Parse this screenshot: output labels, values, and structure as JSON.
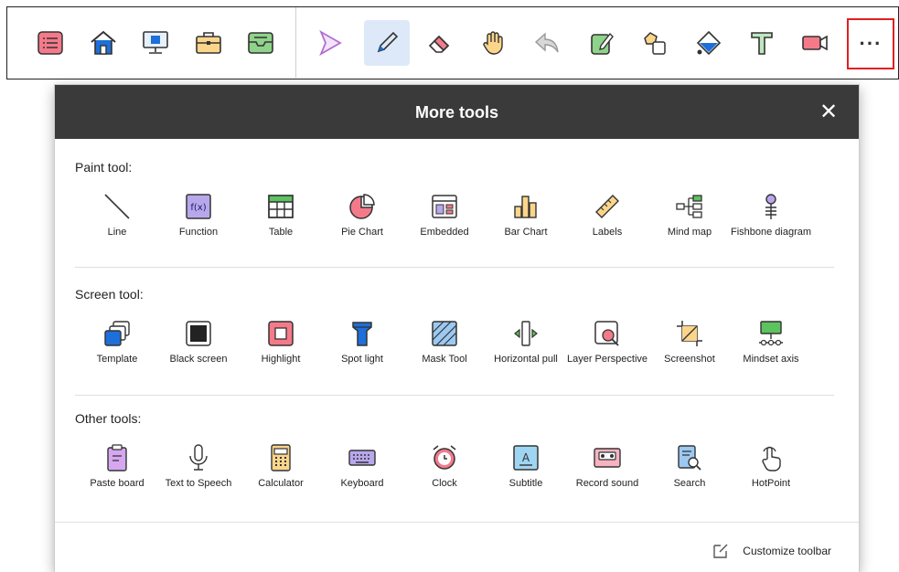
{
  "toolbar": {
    "left_tools": [
      {
        "name": "list-icon"
      },
      {
        "name": "home-icon"
      },
      {
        "name": "desktop-icon"
      },
      {
        "name": "briefcase-icon"
      },
      {
        "name": "inbox-tray-icon"
      }
    ],
    "right_tools": [
      {
        "name": "pointer-arrow-icon"
      },
      {
        "name": "pen-icon",
        "active": true
      },
      {
        "name": "eraser-icon"
      },
      {
        "name": "hand-icon"
      },
      {
        "name": "undo-icon"
      },
      {
        "name": "note-edit-icon"
      },
      {
        "name": "shapes-icon"
      },
      {
        "name": "fill-bucket-icon"
      },
      {
        "name": "text-tool-icon"
      },
      {
        "name": "video-camera-icon"
      }
    ],
    "more_label": "···"
  },
  "dialog": {
    "title": "More tools",
    "close_label": "✕",
    "customize_label": "Customize toolbar",
    "sections": [
      {
        "label": "Paint tool:",
        "tools": [
          {
            "label": "Line",
            "icon": "line-icon"
          },
          {
            "label": "Function",
            "icon": "function-icon"
          },
          {
            "label": "Table",
            "icon": "table-icon"
          },
          {
            "label": "Pie Chart",
            "icon": "pie-chart-icon"
          },
          {
            "label": "Embedded",
            "icon": "embedded-icon"
          },
          {
            "label": "Bar Chart",
            "icon": "bar-chart-icon"
          },
          {
            "label": "Labels",
            "icon": "ruler-icon"
          },
          {
            "label": "Mind  map",
            "icon": "mind-map-icon"
          },
          {
            "label": "Fishbone diagram",
            "icon": "fishbone-icon"
          }
        ]
      },
      {
        "label": "Screen tool:",
        "tools": [
          {
            "label": "Template",
            "icon": "template-icon"
          },
          {
            "label": "Black screen",
            "icon": "black-screen-icon"
          },
          {
            "label": "Highlight",
            "icon": "highlight-icon"
          },
          {
            "label": "Spot light",
            "icon": "spotlight-icon"
          },
          {
            "label": "Mask Tool",
            "icon": "mask-icon"
          },
          {
            "label": "Horizontal pull",
            "icon": "horizontal-pull-icon"
          },
          {
            "label": "Layer Perspective",
            "icon": "layer-perspective-icon"
          },
          {
            "label": "Screenshot",
            "icon": "screenshot-icon"
          },
          {
            "label": "Mindset axis",
            "icon": "mindset-axis-icon"
          }
        ]
      },
      {
        "label": "Other tools:",
        "tools": [
          {
            "label": "Paste board",
            "icon": "clipboard-icon"
          },
          {
            "label": "Text to Speech",
            "icon": "microphone-icon"
          },
          {
            "label": "Calculator",
            "icon": "calculator-icon"
          },
          {
            "label": "Keyboard",
            "icon": "keyboard-icon"
          },
          {
            "label": "Clock",
            "icon": "alarm-clock-icon"
          },
          {
            "label": "Subtitle",
            "icon": "subtitle-icon"
          },
          {
            "label": "Record sound",
            "icon": "cassette-icon"
          },
          {
            "label": "Search",
            "icon": "search-doc-icon"
          },
          {
            "label": "HotPoint",
            "icon": "hotpoint-icon"
          }
        ]
      }
    ]
  },
  "colors": {
    "header_bg": "#3a3a3a",
    "accent_blue": "#1e6fd9",
    "accent_green": "#5cc35f",
    "accent_pink": "#f47a8a",
    "accent_orange": "#f4a640",
    "highlight_red": "#e02020"
  }
}
